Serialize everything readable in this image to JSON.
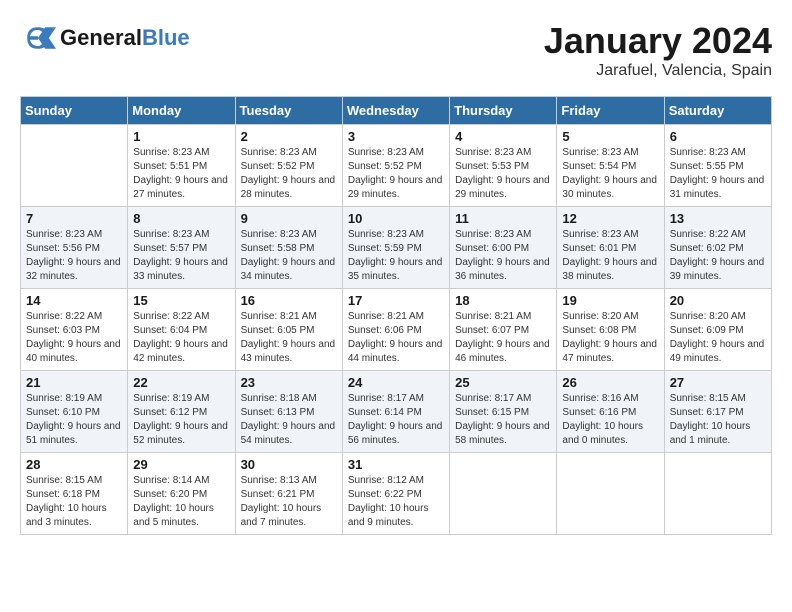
{
  "logo": {
    "line1": "General",
    "line2": "Blue"
  },
  "title": "January 2024",
  "location": "Jarafuel, Valencia, Spain",
  "weekdays": [
    "Sunday",
    "Monday",
    "Tuesday",
    "Wednesday",
    "Thursday",
    "Friday",
    "Saturday"
  ],
  "weeks": [
    [
      {
        "day": "",
        "sunrise": "",
        "sunset": "",
        "daylight": ""
      },
      {
        "day": "1",
        "sunrise": "Sunrise: 8:23 AM",
        "sunset": "Sunset: 5:51 PM",
        "daylight": "Daylight: 9 hours and 27 minutes."
      },
      {
        "day": "2",
        "sunrise": "Sunrise: 8:23 AM",
        "sunset": "Sunset: 5:52 PM",
        "daylight": "Daylight: 9 hours and 28 minutes."
      },
      {
        "day": "3",
        "sunrise": "Sunrise: 8:23 AM",
        "sunset": "Sunset: 5:52 PM",
        "daylight": "Daylight: 9 hours and 29 minutes."
      },
      {
        "day": "4",
        "sunrise": "Sunrise: 8:23 AM",
        "sunset": "Sunset: 5:53 PM",
        "daylight": "Daylight: 9 hours and 29 minutes."
      },
      {
        "day": "5",
        "sunrise": "Sunrise: 8:23 AM",
        "sunset": "Sunset: 5:54 PM",
        "daylight": "Daylight: 9 hours and 30 minutes."
      },
      {
        "day": "6",
        "sunrise": "Sunrise: 8:23 AM",
        "sunset": "Sunset: 5:55 PM",
        "daylight": "Daylight: 9 hours and 31 minutes."
      }
    ],
    [
      {
        "day": "7",
        "sunrise": "Sunrise: 8:23 AM",
        "sunset": "Sunset: 5:56 PM",
        "daylight": "Daylight: 9 hours and 32 minutes."
      },
      {
        "day": "8",
        "sunrise": "Sunrise: 8:23 AM",
        "sunset": "Sunset: 5:57 PM",
        "daylight": "Daylight: 9 hours and 33 minutes."
      },
      {
        "day": "9",
        "sunrise": "Sunrise: 8:23 AM",
        "sunset": "Sunset: 5:58 PM",
        "daylight": "Daylight: 9 hours and 34 minutes."
      },
      {
        "day": "10",
        "sunrise": "Sunrise: 8:23 AM",
        "sunset": "Sunset: 5:59 PM",
        "daylight": "Daylight: 9 hours and 35 minutes."
      },
      {
        "day": "11",
        "sunrise": "Sunrise: 8:23 AM",
        "sunset": "Sunset: 6:00 PM",
        "daylight": "Daylight: 9 hours and 36 minutes."
      },
      {
        "day": "12",
        "sunrise": "Sunrise: 8:23 AM",
        "sunset": "Sunset: 6:01 PM",
        "daylight": "Daylight: 9 hours and 38 minutes."
      },
      {
        "day": "13",
        "sunrise": "Sunrise: 8:22 AM",
        "sunset": "Sunset: 6:02 PM",
        "daylight": "Daylight: 9 hours and 39 minutes."
      }
    ],
    [
      {
        "day": "14",
        "sunrise": "Sunrise: 8:22 AM",
        "sunset": "Sunset: 6:03 PM",
        "daylight": "Daylight: 9 hours and 40 minutes."
      },
      {
        "day": "15",
        "sunrise": "Sunrise: 8:22 AM",
        "sunset": "Sunset: 6:04 PM",
        "daylight": "Daylight: 9 hours and 42 minutes."
      },
      {
        "day": "16",
        "sunrise": "Sunrise: 8:21 AM",
        "sunset": "Sunset: 6:05 PM",
        "daylight": "Daylight: 9 hours and 43 minutes."
      },
      {
        "day": "17",
        "sunrise": "Sunrise: 8:21 AM",
        "sunset": "Sunset: 6:06 PM",
        "daylight": "Daylight: 9 hours and 44 minutes."
      },
      {
        "day": "18",
        "sunrise": "Sunrise: 8:21 AM",
        "sunset": "Sunset: 6:07 PM",
        "daylight": "Daylight: 9 hours and 46 minutes."
      },
      {
        "day": "19",
        "sunrise": "Sunrise: 8:20 AM",
        "sunset": "Sunset: 6:08 PM",
        "daylight": "Daylight: 9 hours and 47 minutes."
      },
      {
        "day": "20",
        "sunrise": "Sunrise: 8:20 AM",
        "sunset": "Sunset: 6:09 PM",
        "daylight": "Daylight: 9 hours and 49 minutes."
      }
    ],
    [
      {
        "day": "21",
        "sunrise": "Sunrise: 8:19 AM",
        "sunset": "Sunset: 6:10 PM",
        "daylight": "Daylight: 9 hours and 51 minutes."
      },
      {
        "day": "22",
        "sunrise": "Sunrise: 8:19 AM",
        "sunset": "Sunset: 6:12 PM",
        "daylight": "Daylight: 9 hours and 52 minutes."
      },
      {
        "day": "23",
        "sunrise": "Sunrise: 8:18 AM",
        "sunset": "Sunset: 6:13 PM",
        "daylight": "Daylight: 9 hours and 54 minutes."
      },
      {
        "day": "24",
        "sunrise": "Sunrise: 8:17 AM",
        "sunset": "Sunset: 6:14 PM",
        "daylight": "Daylight: 9 hours and 56 minutes."
      },
      {
        "day": "25",
        "sunrise": "Sunrise: 8:17 AM",
        "sunset": "Sunset: 6:15 PM",
        "daylight": "Daylight: 9 hours and 58 minutes."
      },
      {
        "day": "26",
        "sunrise": "Sunrise: 8:16 AM",
        "sunset": "Sunset: 6:16 PM",
        "daylight": "Daylight: 10 hours and 0 minutes."
      },
      {
        "day": "27",
        "sunrise": "Sunrise: 8:15 AM",
        "sunset": "Sunset: 6:17 PM",
        "daylight": "Daylight: 10 hours and 1 minute."
      }
    ],
    [
      {
        "day": "28",
        "sunrise": "Sunrise: 8:15 AM",
        "sunset": "Sunset: 6:18 PM",
        "daylight": "Daylight: 10 hours and 3 minutes."
      },
      {
        "day": "29",
        "sunrise": "Sunrise: 8:14 AM",
        "sunset": "Sunset: 6:20 PM",
        "daylight": "Daylight: 10 hours and 5 minutes."
      },
      {
        "day": "30",
        "sunrise": "Sunrise: 8:13 AM",
        "sunset": "Sunset: 6:21 PM",
        "daylight": "Daylight: 10 hours and 7 minutes."
      },
      {
        "day": "31",
        "sunrise": "Sunrise: 8:12 AM",
        "sunset": "Sunset: 6:22 PM",
        "daylight": "Daylight: 10 hours and 9 minutes."
      },
      {
        "day": "",
        "sunrise": "",
        "sunset": "",
        "daylight": ""
      },
      {
        "day": "",
        "sunrise": "",
        "sunset": "",
        "daylight": ""
      },
      {
        "day": "",
        "sunrise": "",
        "sunset": "",
        "daylight": ""
      }
    ]
  ]
}
